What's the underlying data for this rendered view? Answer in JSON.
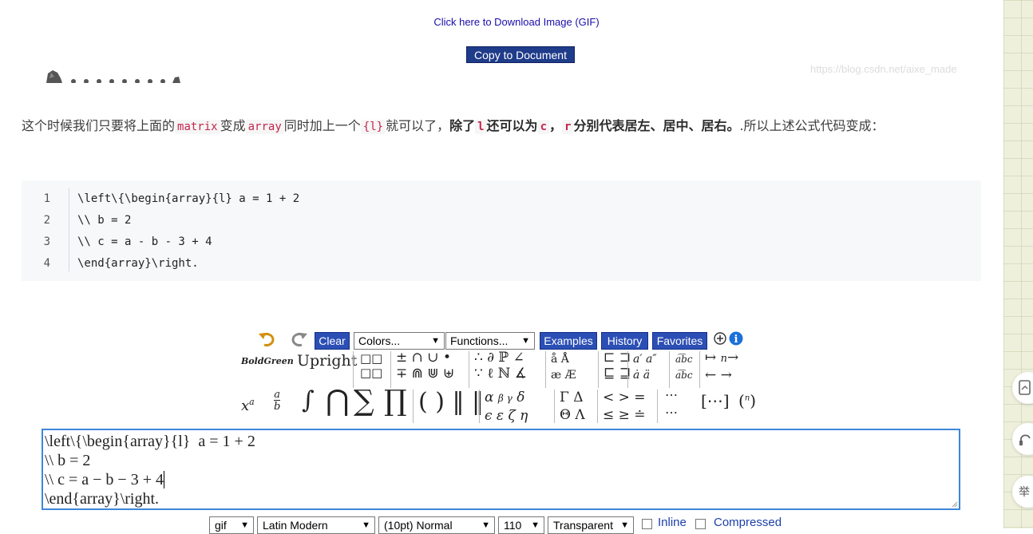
{
  "download_link": "Click here to Download Image (GIF)",
  "copy_button": "Copy to Document",
  "watermark": "https://blog.csdn.net/aixe_made",
  "paragraph": {
    "t1": "这个时候我们只要将上面的",
    "c1": "matrix",
    "t2": "变成",
    "c2": "array",
    "t3": "同时加上一个",
    "c3": "{l}",
    "t4": "就可以了，",
    "b1": "除了",
    "c4": "l",
    "b2": "还可以为",
    "c5": "c",
    "b3": "，",
    "c6": "r",
    "b4": "分别代表居左、居中、居右。",
    "t5": ".所以上述公式代码变成："
  },
  "code_block": {
    "lines": [
      {
        "n": "1",
        "text": "\\left\\{\\begin{array}{l} a = 1 + 2"
      },
      {
        "n": "2",
        "text": "\\\\ b = 2"
      },
      {
        "n": "3",
        "text": "\\\\ c = a - b - 3 + 4"
      },
      {
        "n": "4",
        "text": "\\end{array}\\right."
      }
    ]
  },
  "toolbar": {
    "clear": "Clear",
    "colors": "Colors...",
    "functions": "Functions...",
    "examples": "Examples",
    "history": "History",
    "favorites": "Favorites",
    "bold_green": "BoldGreen",
    "upright": "Upright"
  },
  "editor": {
    "lines": [
      "\\left\\{\\begin{array}{l}  a = 1 + 2",
      "\\\\ b = 2",
      "\\\\ c = a − b − 3 + 4",
      "\\end{array}\\right."
    ]
  },
  "bottom": {
    "format": "gif",
    "font": "Latin Modern",
    "size": "(10pt) Normal",
    "dpi": "110",
    "background": "Transparent",
    "inline_label": "Inline",
    "compressed_label": "Compressed"
  },
  "side_buttons": [
    "举"
  ],
  "colors": {
    "accent_blue": "#2c4fb5",
    "editor_border": "#3d87d8",
    "code_pink": "#c7254e"
  }
}
